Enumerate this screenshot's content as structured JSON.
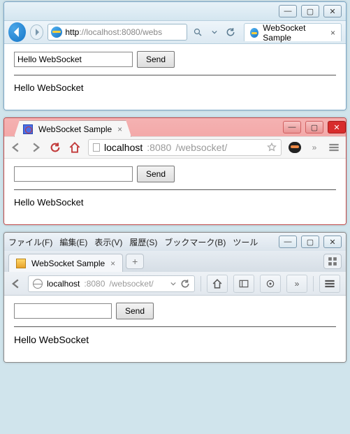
{
  "ie": {
    "win": {
      "min": "—",
      "max": "▢",
      "close": "✕"
    },
    "url": {
      "scheme": "http",
      "hostport": "://localhost:8080",
      "rest": "/webs"
    },
    "tab_title": "WebSocket Sample",
    "page": {
      "input_value": "Hello WebSocket",
      "send_label": "Send",
      "message": "Hello WebSocket"
    }
  },
  "chrome": {
    "win": {
      "min": "—",
      "max": "▢",
      "close": "✕"
    },
    "tab_title": "WebSocket Sample",
    "url": {
      "host": "localhost",
      "port": ":8080",
      "path": "/websocket/"
    },
    "page": {
      "input_value": "",
      "send_label": "Send",
      "message": "Hello WebSocket"
    }
  },
  "firefox": {
    "menu": {
      "file": "ファイル(F)",
      "edit": "編集(E)",
      "view": "表示(V)",
      "history": "履歴(S)",
      "bookmarks": "ブックマーク(B)",
      "tools": "ツール"
    },
    "win": {
      "min": "—",
      "max": "▢",
      "close": "✕"
    },
    "tab_title": "WebSocket Sample",
    "newtab": "+",
    "url": {
      "host": "localhost",
      "port": ":8080",
      "path": "/websocket/"
    },
    "page": {
      "input_value": "",
      "send_label": "Send",
      "message": "Hello WebSocket"
    }
  }
}
